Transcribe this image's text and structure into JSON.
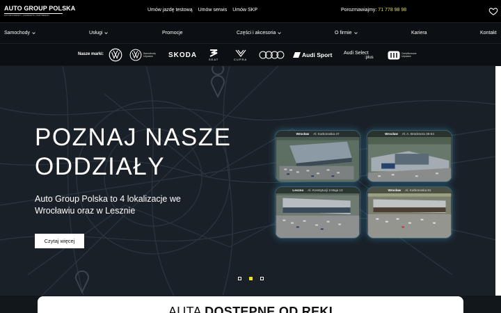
{
  "header": {
    "logo_title": "AUTO GROUP POLSKA",
    "logo_sub": "AUTORYZOWANY | KOMISANTA | PARTNERSKI",
    "links": [
      "Umów jazdę testową",
      "Umów serwis",
      "Umów SKP"
    ],
    "phone_label": "Porozmawiajmy: ",
    "phone_number": "71 778 98 98"
  },
  "nav": {
    "items": [
      {
        "label": "Samochody"
      },
      {
        "label": "Usługi"
      },
      {
        "label": "Promocje"
      },
      {
        "label": "Części i akcesoria"
      },
      {
        "label": "O firmie"
      },
      {
        "label": "Kariera"
      },
      {
        "label": "Kontakt"
      }
    ]
  },
  "brands": {
    "label": "Nasze marki:",
    "skoda": "SKODA",
    "seat": "SEAT",
    "cupra": "CUPRA",
    "audi_sport": "Audi Sport",
    "audi_select_1": "Audi Select",
    "audi_select_2": ":plus",
    "vw_used_1": "Samochody",
    "vw_used_2": "Używane",
    "cert_1": "Certyfikowane",
    "cert_2": "Używane"
  },
  "hero": {
    "title_line1": "POZNAJ NASZE",
    "title_line2": "ODDZIAŁY",
    "desc": "Auto Group Polska to 4 lokalizacje we Wrocławiu oraz w Lesznie",
    "button": "Czytaj więcej",
    "cards": [
      {
        "city": "Wrocław",
        "addr": "Al. Karkonoska 47"
      },
      {
        "city": "Wrocław",
        "addr": "Al. A. Brücknera 38-54"
      },
      {
        "city": "Leszno",
        "addr": "Al. Konstytucji 3 Maja 13"
      },
      {
        "city": "Wrocław",
        "addr": "Al. Karkonoska 81"
      }
    ],
    "active_slide": 2,
    "slides": 3
  },
  "section": {
    "title_light": "AUTA ",
    "title_bold": "DOSTĘPNE OD RĘKI"
  },
  "colors": {
    "accent": "#e9e12a",
    "background": "#13171c"
  }
}
